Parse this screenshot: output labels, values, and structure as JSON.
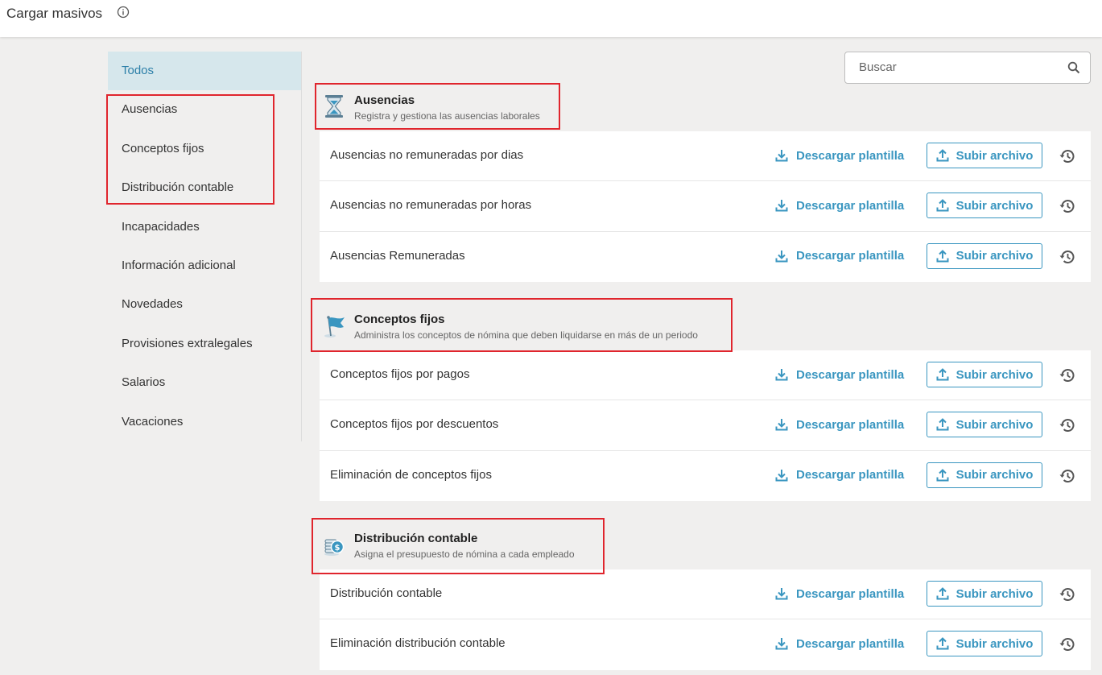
{
  "header": {
    "title": "Cargar masivos",
    "info_icon": "info-circle-icon"
  },
  "search": {
    "placeholder": "Buscar",
    "value": ""
  },
  "sidebar": {
    "items": [
      {
        "label": "Todos",
        "active": true
      },
      {
        "label": "Ausencias"
      },
      {
        "label": "Conceptos fijos"
      },
      {
        "label": "Distribución contable"
      },
      {
        "label": "Incapacidades"
      },
      {
        "label": "Información adicional"
      },
      {
        "label": "Novedades"
      },
      {
        "label": "Provisiones extralegales"
      },
      {
        "label": "Salarios"
      },
      {
        "label": "Vacaciones"
      }
    ]
  },
  "actions": {
    "download_label": "Descargar plantilla",
    "upload_label": "Subir archivo",
    "download_icon": "download-icon",
    "upload_icon": "upload-icon",
    "history_icon": "history-icon"
  },
  "colors": {
    "accent": "#3a96c0",
    "highlight": "#e0252d",
    "active_bg": "#d6e7ec",
    "background": "#f0efee"
  },
  "sections": [
    {
      "title": "Ausencias",
      "subtitle": "Registra y gestiona las ausencias laborales",
      "icon": "hourglass-icon",
      "rows": [
        {
          "label": "Ausencias no remuneradas por dias"
        },
        {
          "label": "Ausencias no remuneradas por horas"
        },
        {
          "label": "Ausencias Remuneradas"
        }
      ]
    },
    {
      "title": "Conceptos fijos",
      "subtitle": "Administra los conceptos de nómina que deben liquidarse en más de un periodo",
      "icon": "flag-icon",
      "rows": [
        {
          "label": "Conceptos fijos por pagos"
        },
        {
          "label": "Conceptos fijos por descuentos"
        },
        {
          "label": "Eliminación de conceptos fijos"
        }
      ]
    },
    {
      "title": "Distribución contable",
      "subtitle": "Asigna el presupuesto de nómina a cada empleado",
      "icon": "coins-dollar-icon",
      "rows": [
        {
          "label": "Distribución contable"
        },
        {
          "label": "Eliminación distribución contable"
        }
      ]
    }
  ]
}
